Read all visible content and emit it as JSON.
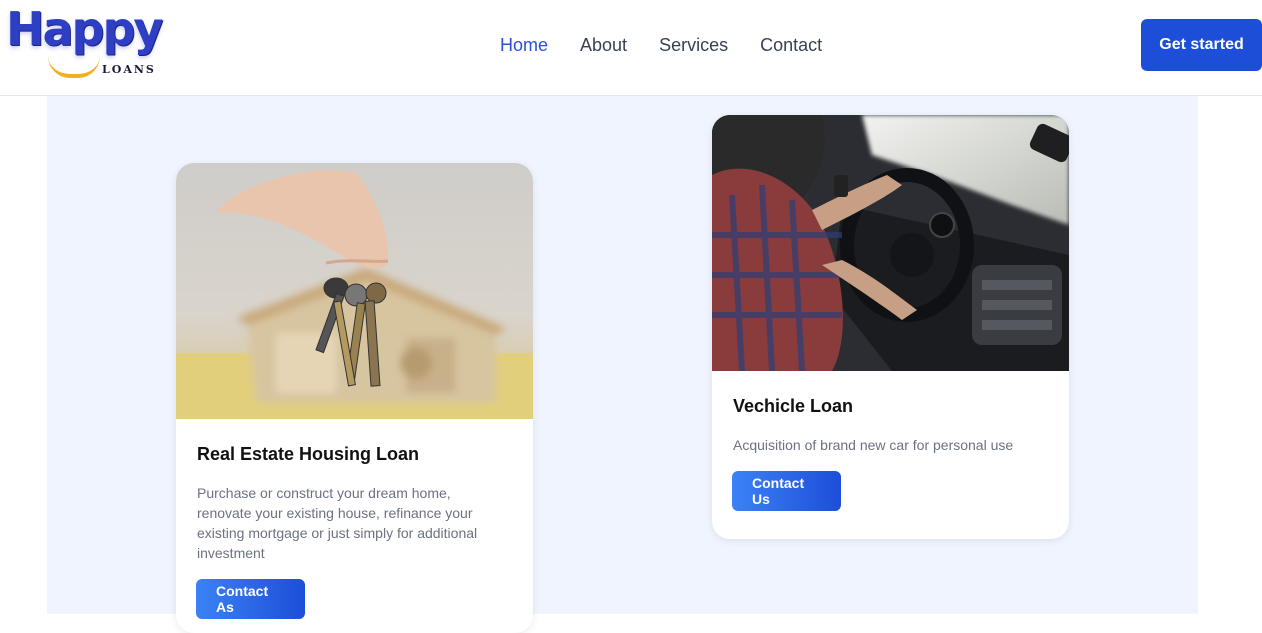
{
  "brand": {
    "logo_word": "Happy",
    "logo_sub": "LOANS"
  },
  "nav": {
    "items": [
      {
        "label": "Home",
        "active": true
      },
      {
        "label": "About",
        "active": false
      },
      {
        "label": "Services",
        "active": false
      },
      {
        "label": "Contact",
        "active": false
      }
    ],
    "cta_label": "Get started"
  },
  "cards": [
    {
      "title": "Real Estate Housing Loan",
      "description": "Purchase or construct your dream home, renovate your existing house, refinance your existing mortgage or just simply for additional investment",
      "button_label": "Contact As",
      "image": "house-keys-photo"
    },
    {
      "title": "Vechicle Loan",
      "description": "Acquisition of brand new car for personal use",
      "button_label": "Contact Us",
      "image": "car-driver-photo"
    }
  ],
  "colors": {
    "accent": "#1d4ed8",
    "nav_active": "#2d4fd6",
    "background": "#eff4fe"
  }
}
